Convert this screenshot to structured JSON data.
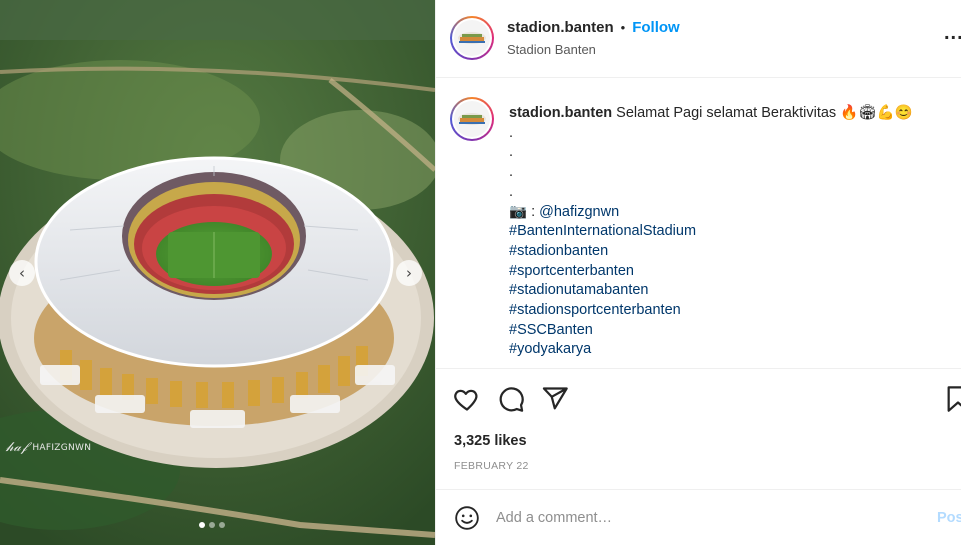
{
  "post": {
    "username": "stadion.banten",
    "separator": "•",
    "follow_label": "Follow",
    "location": "Stadion Banten",
    "more_label": "..."
  },
  "caption": {
    "username": "stadion.banten",
    "text": "Selamat Pagi selamat Beraktivitas 🔥🏟💪😊",
    "dot_lines": [
      ".",
      ".",
      ".",
      "."
    ],
    "credit_prefix": "📷 : ",
    "credit_handle": "@hafizgnwn",
    "hashtags": [
      "#BantenInternationalStadium",
      "#stadionbanten",
      "#sportcenterbanten",
      "#stadionutamabanten",
      "#stadionsportcenterbanten",
      "#SSCBanten",
      "#yodyakarya"
    ]
  },
  "media": {
    "watermark": "HAFIZGNWN",
    "signature": "𝒽𝒶𝒻",
    "prev_label": "‹",
    "next_label": "›",
    "slides_total": 3,
    "active_slide": 1
  },
  "actions": {
    "likes": "3,325 likes",
    "date": "FEBRUARY 22",
    "icons": [
      "heart-icon",
      "comment-icon",
      "share-icon",
      "bookmark-icon"
    ]
  },
  "comment": {
    "placeholder": "Add a comment…",
    "post_label": "Post"
  },
  "colors": {
    "link": "#00376b",
    "follow": "#0095f6",
    "post_disabled": "#b3dbff"
  }
}
